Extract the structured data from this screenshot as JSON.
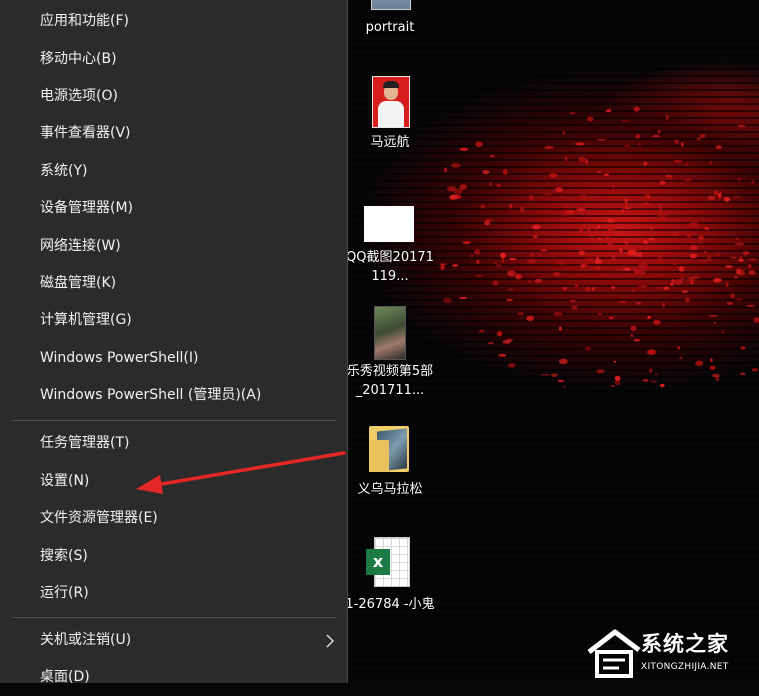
{
  "menu": {
    "items": [
      {
        "label": "应用和功能(F)"
      },
      {
        "label": "移动中心(B)"
      },
      {
        "label": "电源选项(O)"
      },
      {
        "label": "事件查看器(V)"
      },
      {
        "label": "系统(Y)"
      },
      {
        "label": "设备管理器(M)"
      },
      {
        "label": "网络连接(W)"
      },
      {
        "label": "磁盘管理(K)"
      },
      {
        "label": "计算机管理(G)"
      },
      {
        "label": "Windows PowerShell(I)"
      },
      {
        "label": "Windows PowerShell (管理员)(A)"
      },
      {
        "label": "任务管理器(T)"
      },
      {
        "label": "设置(N)"
      },
      {
        "label": "文件资源管理器(E)"
      },
      {
        "label": "搜索(S)"
      },
      {
        "label": "运行(R)"
      },
      {
        "label": "关机或注销(U)",
        "icon": "chevron-right-icon"
      },
      {
        "label": "桌面(D)"
      }
    ]
  },
  "desktop": {
    "icons": [
      {
        "label": "portrait",
        "icon": "image-file-icon"
      },
      {
        "label": "马远航",
        "icon": "photo-file-icon"
      },
      {
        "label": "QQ截图20171119...",
        "icon": "image-file-icon"
      },
      {
        "label": "乐秀视频第5部_201711...",
        "icon": "video-file-icon"
      },
      {
        "label": "义乌马拉松",
        "icon": "folder-icon"
      },
      {
        "label": "1-26784 -小鬼",
        "icon": "excel-file-icon"
      }
    ]
  },
  "watermark": {
    "title": "系统之家",
    "url": "XITONGZHIJIA.NET"
  },
  "colors": {
    "menu_bg": "#2b2b2b",
    "menu_text": "#f2f2f2",
    "arrow": "#e32626",
    "desktop_accent": "#c81515"
  }
}
